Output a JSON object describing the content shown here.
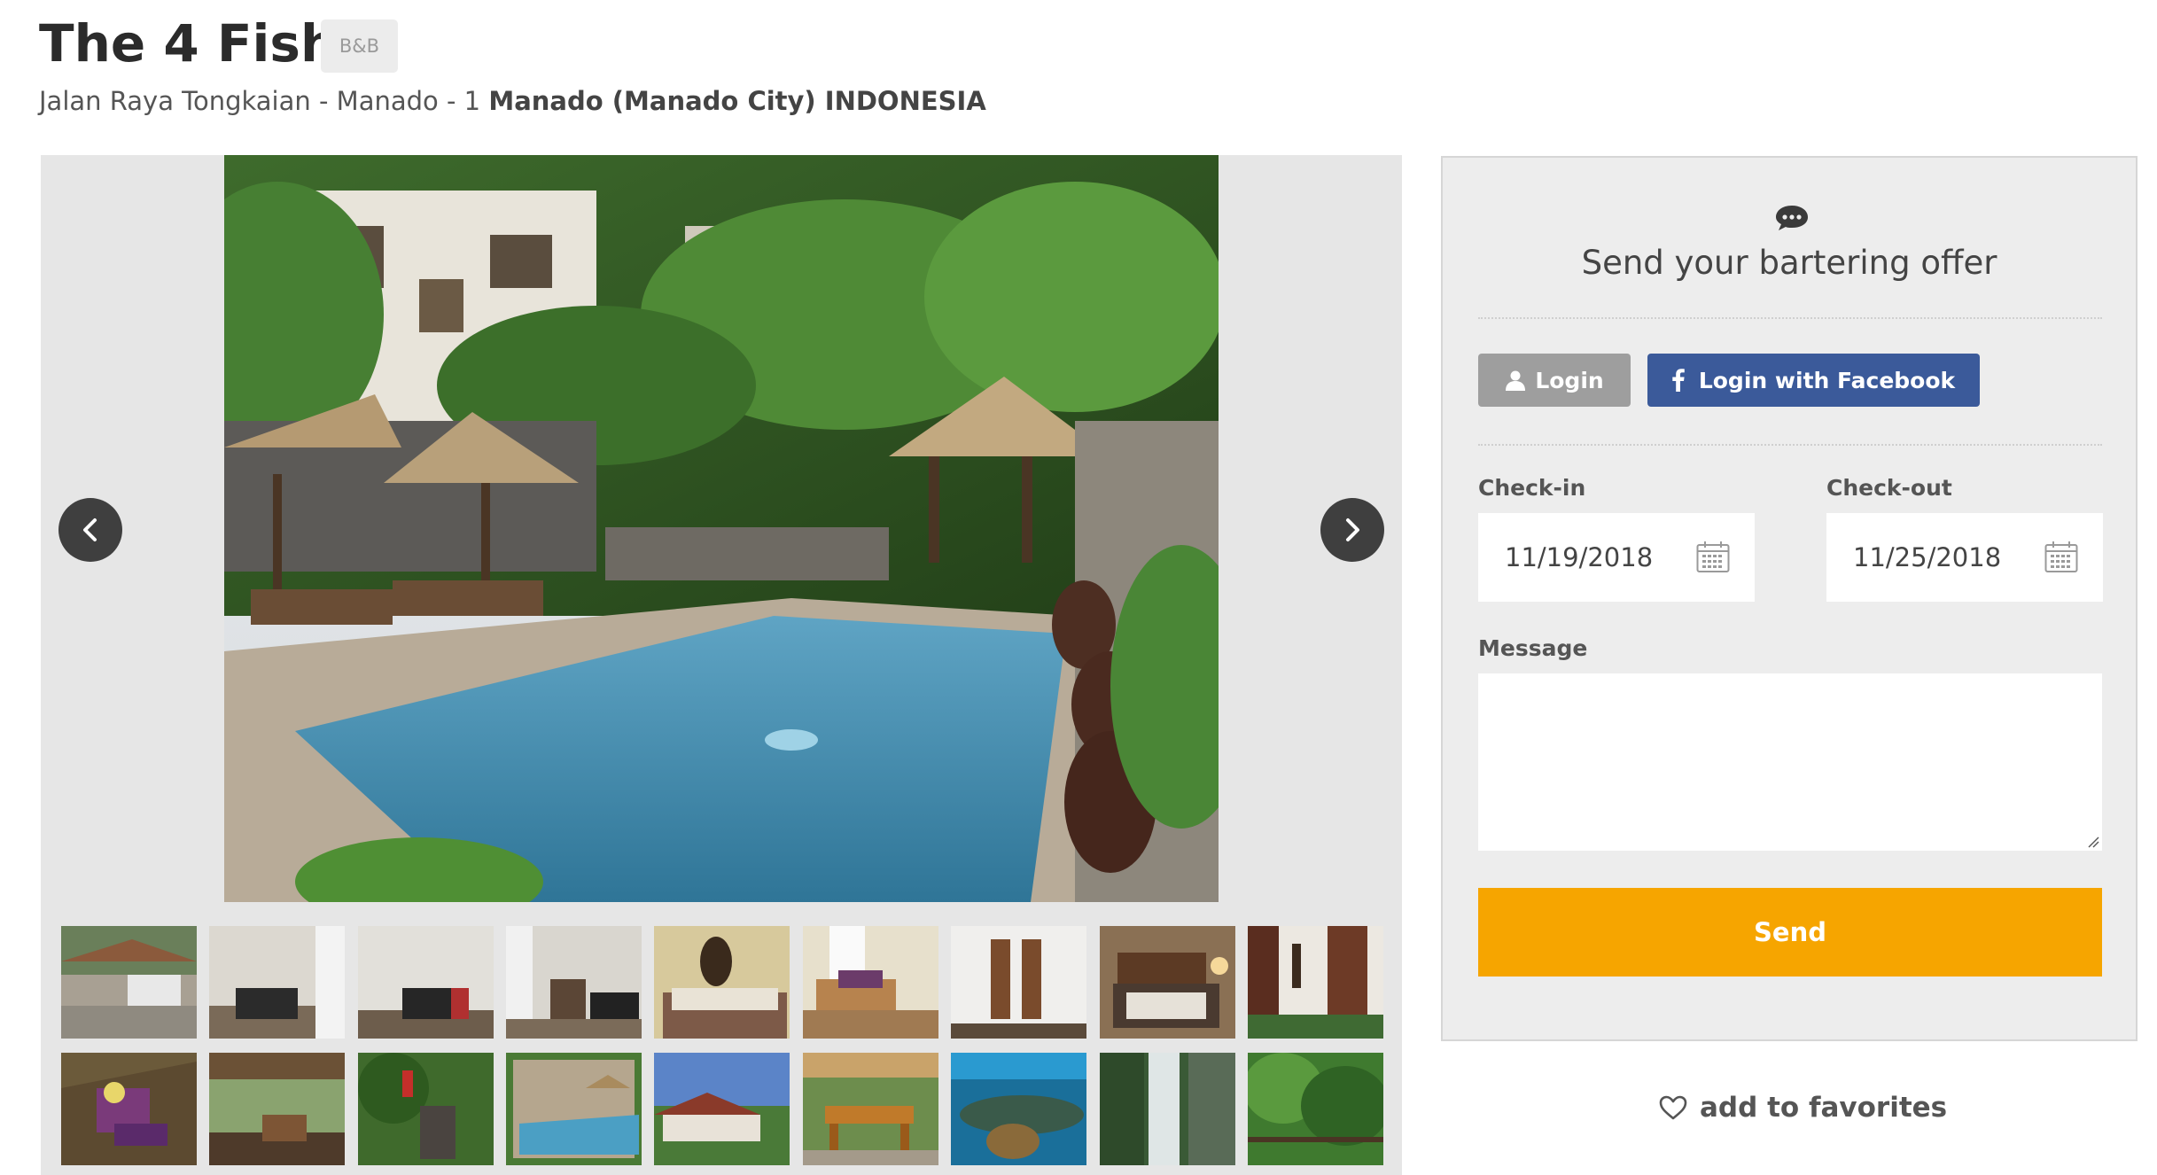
{
  "listing": {
    "title": "The 4 Fish",
    "badge": "B&B",
    "address_prefix": "Jalan Raya Tongkaian - Manado - 1",
    "address_city": "Manado (Manado City) INDONESIA"
  },
  "gallery": {
    "main_photo_icon": "resort-pool-photo",
    "prev_icon": "chevron-left-icon",
    "next_icon": "chevron-right-icon",
    "thumbnails_row1": [
      "driveway",
      "living-room",
      "lounge",
      "hallway",
      "bedroom-mirror",
      "bedroom-desk",
      "carvings",
      "bedroom-lamp",
      "doorway"
    ],
    "thumbnails_row2": [
      "towels",
      "veranda",
      "garden-statue",
      "pool",
      "bungalows",
      "dining-terrace",
      "reef",
      "waterfall",
      "forest"
    ]
  },
  "offer": {
    "heading": "Send your bartering offer",
    "chat_icon": "chat-bubble-icon",
    "login_label": "Login",
    "facebook_label": "Login with Facebook",
    "checkin_label": "Check-in",
    "checkin_value": "11/19/2018",
    "checkout_label": "Check-out",
    "checkout_value": "11/25/2018",
    "message_label": "Message",
    "message_value": "",
    "send_label": "Send"
  },
  "favorites": {
    "label": "add to favorites",
    "icon": "heart-icon"
  },
  "colors": {
    "send_button": "#f6a500",
    "facebook_button": "#3b5a9a",
    "login_button": "#9e9e9e",
    "panel_bg": "#ededed"
  }
}
